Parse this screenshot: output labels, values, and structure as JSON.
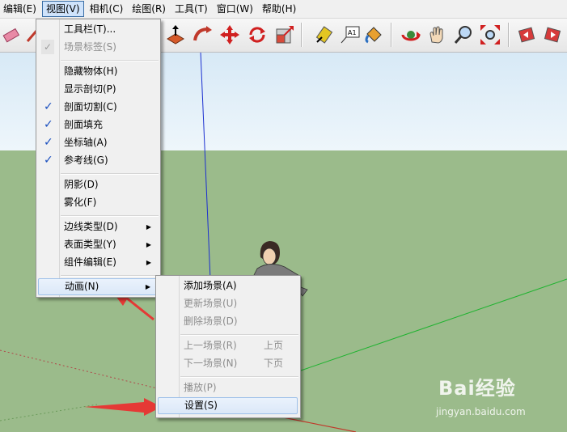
{
  "menubar": {
    "items": [
      {
        "label": "编辑(E)"
      },
      {
        "label": "视图(V)"
      },
      {
        "label": "相机(C)"
      },
      {
        "label": "绘图(R)"
      },
      {
        "label": "工具(T)"
      },
      {
        "label": "窗口(W)"
      },
      {
        "label": "帮助(H)"
      }
    ]
  },
  "toolbar": {
    "icons": [
      "eraser-icon",
      "pencil-icon",
      "push-pull-icon",
      "follow-me-icon",
      "move-icon",
      "rotate-icon",
      "scale-icon",
      "tape-measure-icon",
      "text-icon",
      "paint-bucket-icon",
      "orbit-icon",
      "pan-icon",
      "zoom-icon",
      "zoom-extents-icon",
      "previous-view-icon",
      "next-view-icon"
    ],
    "text_icon_label": "A1"
  },
  "view_menu": {
    "items": [
      {
        "label": "工具栏(T)...",
        "checked": false,
        "disabled": false
      },
      {
        "label": "场景标签(S)",
        "checked": true,
        "disabled": true
      },
      {
        "label": "隐藏物体(H)",
        "checked": false,
        "disabled": false
      },
      {
        "label": "显示剖切(P)",
        "checked": false,
        "disabled": false
      },
      {
        "label": "剖面切割(C)",
        "checked": true,
        "disabled": false
      },
      {
        "label": "剖面填充",
        "checked": true,
        "disabled": false
      },
      {
        "label": "坐标轴(A)",
        "checked": true,
        "disabled": false
      },
      {
        "label": "参考线(G)",
        "checked": true,
        "disabled": false
      },
      {
        "label": "阴影(D)",
        "checked": false,
        "disabled": false
      },
      {
        "label": "雾化(F)",
        "checked": false,
        "disabled": false
      },
      {
        "label": "边线类型(D)",
        "submenu": true
      },
      {
        "label": "表面类型(Y)",
        "submenu": true
      },
      {
        "label": "组件编辑(E)",
        "submenu": true
      },
      {
        "label": "动画(N)",
        "submenu": true,
        "highlighted": true
      }
    ],
    "check_glyph": "✓"
  },
  "animation_menu": {
    "items": [
      {
        "label": "添加场景(A)",
        "disabled": false
      },
      {
        "label": "更新场景(U)",
        "disabled": true
      },
      {
        "label": "删除场景(D)",
        "disabled": true
      },
      {
        "label": "上一场景(R)",
        "shortcut": "上页",
        "disabled": true
      },
      {
        "label": "下一场景(N)",
        "shortcut": "下页",
        "disabled": true
      },
      {
        "label": "播放(P)",
        "disabled": true
      },
      {
        "label": "设置(S)",
        "disabled": false,
        "highlighted": true
      }
    ]
  },
  "watermark": {
    "brand": "Bai经验",
    "url": "jingyan.baidu.com"
  },
  "colors": {
    "sky": "#d7e9f6",
    "ground": "#9bbb8b",
    "blue_axis": "#1b2fd0",
    "green_axis": "#1fb330",
    "red_axis": "#c0392b",
    "annotation_arrow": "#e53935"
  }
}
